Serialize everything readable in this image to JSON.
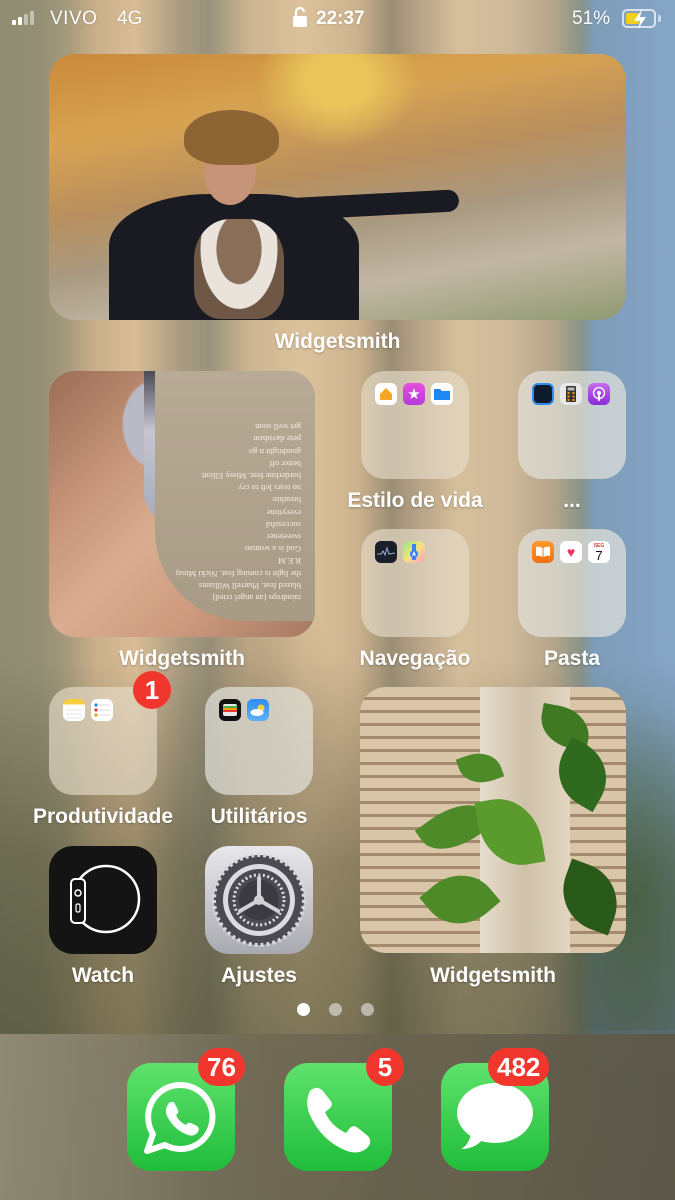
{
  "status_bar": {
    "signal_bars_active": 2,
    "signal_bars_total": 4,
    "carrier": "VIVO",
    "network": "4G",
    "time": "22:37",
    "battery_percent_label": "51%",
    "battery_level": 0.51,
    "charging": true,
    "battery_fill_color": "#f4d01d"
  },
  "widgets": [
    {
      "id": "top",
      "label": "Widgetsmith",
      "content": "photo-woman-hat-hillside"
    },
    {
      "id": "album",
      "label": "Widgetsmith",
      "content": "album-tracklist-rotated",
      "tracklist": [
        "get well soon",
        "pete davidson",
        "goodnight n go",
        "better off",
        "borderline feat. Missy Elliott",
        "no tears left to cry",
        "breathin",
        "everytime",
        "successful",
        "sweetener",
        "God is a woman",
        "R.E.M",
        "the light is coming feat. Nicki Minaj",
        "blazed feat. Pharrell Williams",
        "raindrops (an angel cried)"
      ]
    },
    {
      "id": "plant",
      "label": "Widgetsmith",
      "content": "photo-plant-blinds"
    }
  ],
  "folders": [
    {
      "label": "Estilo de vida",
      "apps": [
        "home-icon",
        "itunes-store-icon",
        "files-icon"
      ]
    },
    {
      "label": "...",
      "apps": [
        "watch-face-icon",
        "calculator-icon",
        "podcasts-icon"
      ]
    },
    {
      "label": "Navegação",
      "apps": [
        "stocks-icon",
        "maps-icon"
      ]
    },
    {
      "label": "Pasta",
      "apps": [
        "books-icon",
        "health-icon",
        "calendar-icon"
      ],
      "calendar_day": "SEG",
      "calendar_date": "7"
    },
    {
      "label": "Produtividade",
      "apps": [
        "notes-icon",
        "reminders-icon"
      ],
      "badge": "1"
    },
    {
      "label": "Utilitários",
      "apps": [
        "wallet-icon",
        "weather-icon"
      ]
    }
  ],
  "apps": [
    {
      "label": "Watch",
      "icon": "watch-icon"
    },
    {
      "label": "Ajustes",
      "icon": "settings-icon"
    }
  ],
  "page_dots": {
    "total": 3,
    "active": 0
  },
  "dock": [
    {
      "name": "WhatsApp",
      "icon": "whatsapp-icon",
      "badge": "76"
    },
    {
      "name": "Telefone",
      "icon": "phone-icon",
      "badge": "5"
    },
    {
      "name": "Mensagens",
      "icon": "messages-icon",
      "badge": "482"
    }
  ]
}
